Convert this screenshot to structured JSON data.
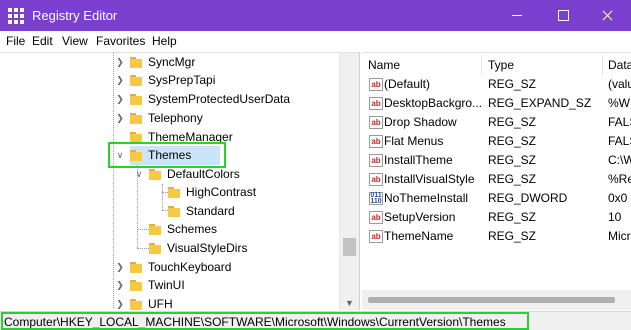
{
  "window": {
    "title": "Registry Editor",
    "titlebar_color": "#7b3fd0",
    "highlight_color": "#2bd12b"
  },
  "menu": [
    "File",
    "Edit",
    "View",
    "Favorites",
    "Help"
  ],
  "tree": {
    "items": [
      {
        "label": "SyncMgr",
        "expanded": false
      },
      {
        "label": "SysPrepTapi",
        "expanded": false
      },
      {
        "label": "SystemProtectedUserData",
        "expanded": false
      },
      {
        "label": "Telephony",
        "expanded": false
      },
      {
        "label": "ThemeManager",
        "expanded": false
      },
      {
        "label": "Themes",
        "expanded": true,
        "selected": true
      },
      {
        "label": "DefaultColors",
        "expanded": true
      },
      {
        "label": "HighContrast",
        "expanded": false
      },
      {
        "label": "Standard",
        "expanded": false
      },
      {
        "label": "Schemes",
        "expanded": false
      },
      {
        "label": "VisualStyleDirs",
        "expanded": false
      },
      {
        "label": "TouchKeyboard",
        "expanded": false
      },
      {
        "label": "TwinUI",
        "expanded": false
      },
      {
        "label": "UFH",
        "expanded": false
      }
    ]
  },
  "list": {
    "columns": [
      "Name",
      "Type",
      "Data"
    ],
    "rows": [
      {
        "name": "(Default)",
        "type": "REG_SZ",
        "data": "(valu",
        "icon": "ab"
      },
      {
        "name": "DesktopBackgro...",
        "type": "REG_EXPAND_SZ",
        "data": "%W",
        "icon": "ab"
      },
      {
        "name": "Drop Shadow",
        "type": "REG_SZ",
        "data": "FALS",
        "icon": "ab"
      },
      {
        "name": "Flat Menus",
        "type": "REG_SZ",
        "data": "FALS",
        "icon": "ab"
      },
      {
        "name": "InstallTheme",
        "type": "REG_SZ",
        "data": "C:\\W",
        "icon": "ab"
      },
      {
        "name": "InstallVisualStyle",
        "type": "REG_SZ",
        "data": "%Re",
        "icon": "ab"
      },
      {
        "name": "NoThemeInstall",
        "type": "REG_DWORD",
        "data": "0x0",
        "icon": "dword"
      },
      {
        "name": "SetupVersion",
        "type": "REG_SZ",
        "data": "10",
        "icon": "ab"
      },
      {
        "name": "ThemeName",
        "type": "REG_SZ",
        "data": "Micr",
        "icon": "ab"
      }
    ]
  },
  "icons": {
    "string_value": "ab",
    "dword_value": "011\n110"
  },
  "status": {
    "path": "Computer\\HKEY_LOCAL_MACHINE\\SOFTWARE\\Microsoft\\Windows\\CurrentVersion\\Themes"
  }
}
